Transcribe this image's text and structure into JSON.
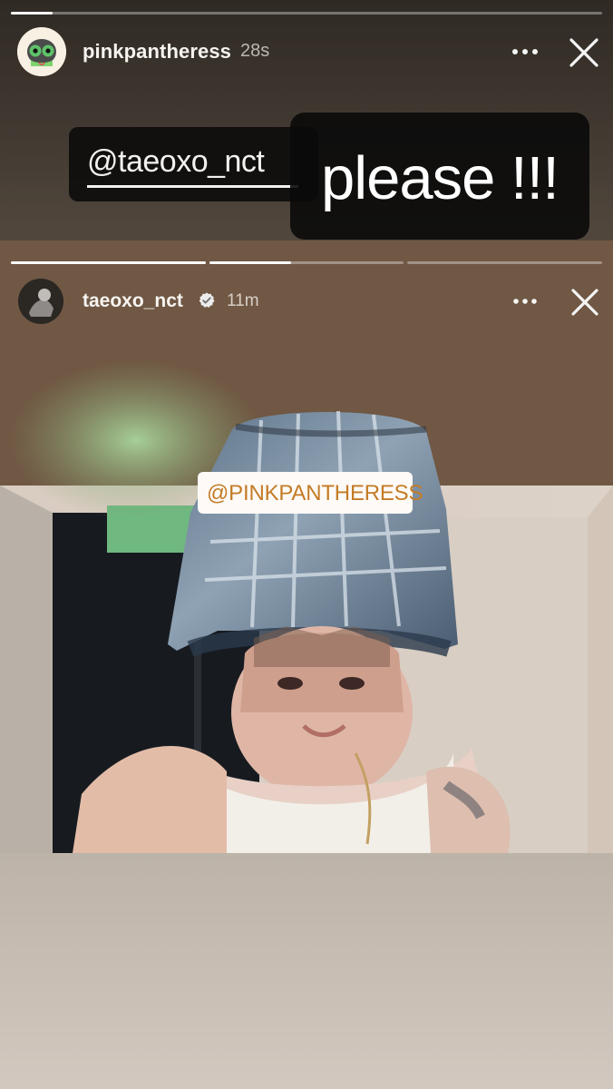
{
  "story": {
    "progress_fraction": 0.07,
    "username": "pinkpantheress",
    "time_ago": "28s",
    "mention_text": "@taeoxo_nct",
    "caption_text": "please !!!"
  },
  "repost": {
    "username": "taeoxo_nct",
    "time_ago": "11m",
    "mention_text": "@PINKPANTHERESS",
    "progress": [
      1,
      0.42,
      0
    ],
    "verified": true
  },
  "icons": {
    "main_avatar": "powerpuff-avatar-icon",
    "more": "more-options-icon",
    "close": "close-icon",
    "verified": "verified-icon",
    "mention": "at-icon"
  },
  "colors": {
    "white": "#ffffff",
    "orange_mention": "#c47b26",
    "sticker_black": "#0b0b0b",
    "bg_dark": "#2f2a24",
    "bg_light": "#d2c8bf"
  }
}
